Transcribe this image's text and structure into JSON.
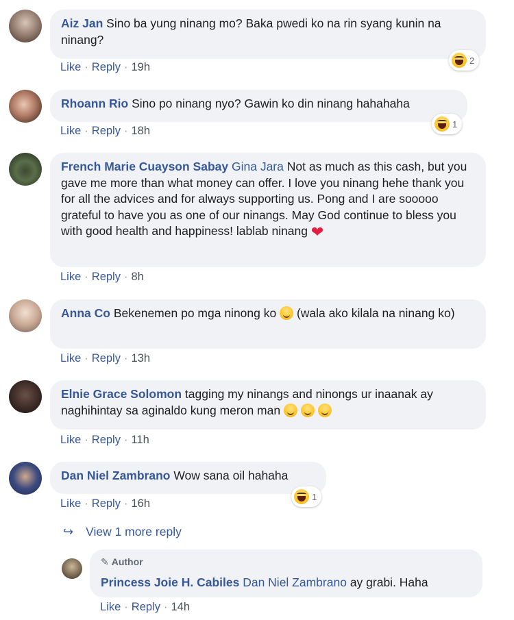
{
  "comments": [
    {
      "name": "Aiz Jan",
      "text": "Sino ba yung ninang mo? Baka pwedi ko na rin syang kunin na ninang?",
      "like": "Like",
      "reply": "Reply",
      "time": "19h",
      "reaction_count": "2"
    },
    {
      "name": "Rhoann Rio",
      "text": "Sino po ninang nyo? Gawin ko din ninang hahahaha",
      "like": "Like",
      "reply": "Reply",
      "time": "18h",
      "reaction_count": "1"
    },
    {
      "name": "French Marie Cuayson Sabay",
      "tag": "Gina Jara",
      "text": "Not as much as this cash, but you gave me more than what money can offer. I love you ninang hehe thank you for all the advices and for always supporting us. Pong and I are sooooo grateful to have you as one of our ninangs. May God continue to bless you with good health and happiness! lablab ninang",
      "emoji": "❤",
      "like": "Like",
      "reply": "Reply",
      "time": "8h"
    },
    {
      "name": "Anna Co",
      "text": "Bekenemen po mga ninong ko",
      "text2": "(wala ako kilala na ninang ko)",
      "like": "Like",
      "reply": "Reply",
      "time": "13h"
    },
    {
      "name": "Elnie Grace Solomon",
      "text": "tagging my ninangs and ninongs ur inaanak ay naghihintay sa aginaldo kung meron man",
      "like": "Like",
      "reply": "Reply",
      "time": "11h"
    },
    {
      "name": "Dan Niel Zambrano",
      "text": "Wow sana oil hahaha",
      "like": "Like",
      "reply": "Reply",
      "time": "16h",
      "reaction_count": "1"
    }
  ],
  "view_more": "View 1 more reply",
  "reply": {
    "badge": "Author",
    "name": "Princess Joie H. Cabiles",
    "tag": "Dan Niel Zambrano",
    "text": "ay grabi. Haha",
    "like": "Like",
    "reply": "Reply",
    "time": "14h"
  },
  "colors": {
    "link": "#365899",
    "bubble": "#f0f2f5",
    "meta": "#4b4f56",
    "heart": "#e41e3f"
  },
  "icons": {
    "reaction": "haha-reaction-icon",
    "reply_arrow": "reply-arrow-icon",
    "author_badge": "pencil-icon"
  }
}
